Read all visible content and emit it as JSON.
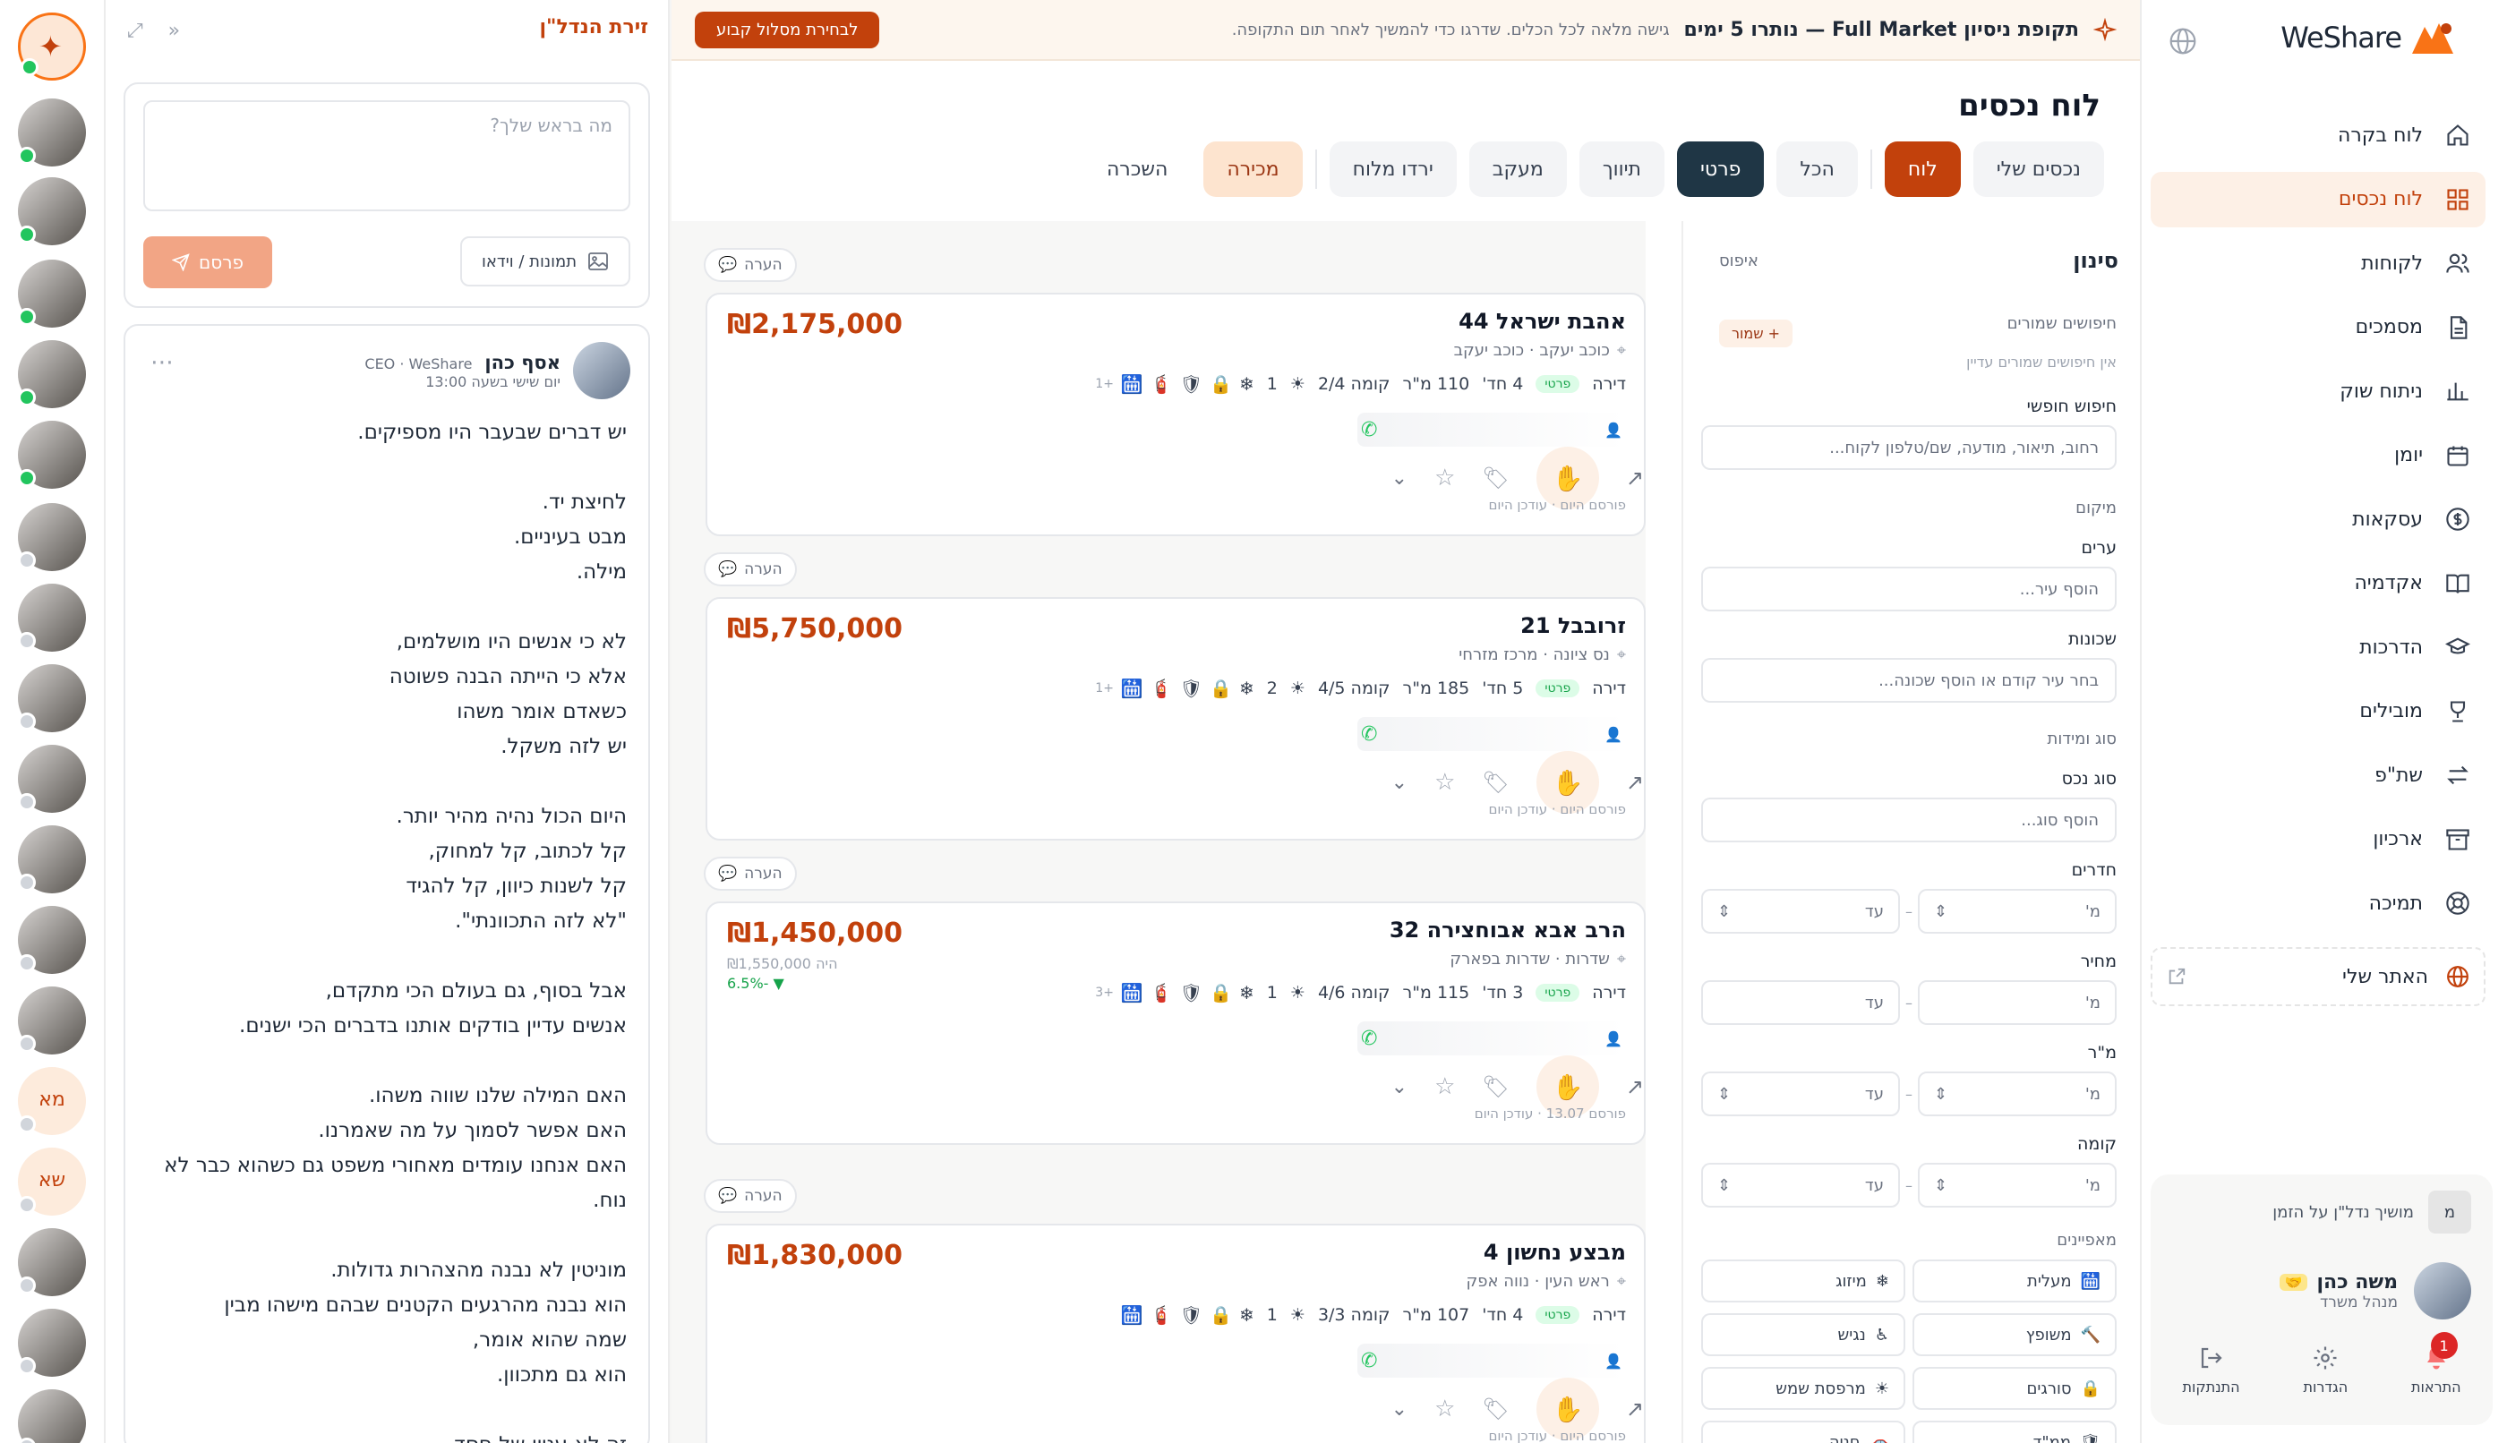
{
  "nav": {
    "logo": "WeShare",
    "items": [
      {
        "label": "לוח בקרה",
        "icon": "home-icon"
      },
      {
        "label": "לוח נכסים",
        "icon": "grid-icon",
        "active": true
      },
      {
        "label": "לקוחות",
        "icon": "users-icon"
      },
      {
        "label": "מסמכים",
        "icon": "document-icon"
      },
      {
        "label": "ניתוח שוק",
        "icon": "bar-chart-icon"
      },
      {
        "label": "יומן",
        "icon": "calendar-icon"
      },
      {
        "label": "עסקאות",
        "icon": "dollar-icon"
      },
      {
        "label": "אקדמיה",
        "icon": "book-icon"
      },
      {
        "label": "הדרכות",
        "icon": "graduation-cap-icon"
      },
      {
        "label": "מובילים",
        "icon": "trophy-icon"
      },
      {
        "label": "שת\"פ",
        "icon": "swap-icon"
      },
      {
        "label": "ארכיון",
        "icon": "archive-icon"
      },
      {
        "label": "תמיכה",
        "icon": "lifebuoy-icon"
      }
    ],
    "my_site": "האתר שלי",
    "sync": {
      "initial": "מ",
      "text": "מושיך נדל\"ן על הזמן"
    },
    "user": {
      "name": "משה כהן",
      "role": "מנהל משרד"
    },
    "actions": {
      "notifications": "התראות",
      "notifications_count": "1",
      "settings": "הגדרות",
      "logout": "התנתקות"
    }
  },
  "banner": {
    "title": "תקופת ניסיון Full Market — נותרו 5 ימים",
    "text": "גישה מלאה לכל הכלים. שדרגו כדי להמשיך לאחר תום התקופה.",
    "cta": "לבחירת מסלול קבוע"
  },
  "main": {
    "title": "לוח נכסים",
    "tabs_group1": [
      "נכסים שלי",
      "לוח"
    ],
    "tabs_group2": [
      "הכל",
      "פרטי",
      "תיווך",
      "מעקב",
      "ירדו מלוח"
    ],
    "tabs_group3": [
      "מכירה",
      "השכרה"
    ]
  },
  "filters": {
    "title": "סינון",
    "reset": "איפוס",
    "saved_label": "חיפושים שמורים",
    "save_btn": "+ שמור",
    "saved_empty": "אין חיפושים שמורים עדיין",
    "free_search_label": "חיפוש חופשי",
    "free_search_placeholder": "רחוב, תיאור, מודעה, שם/טלפון לקוח...",
    "location_label": "מיקום",
    "cities_label": "ערים",
    "cities_placeholder": "הוסף עיר...",
    "hoods_label": "שכונות",
    "hoods_placeholder": "בחר עיר קודם או הוסף שכונה...",
    "type_section": "סוג ומידות",
    "type_label": "סוג נכס",
    "type_placeholder": "הוסף סוג...",
    "rooms_label": "חדרים",
    "price_label": "מחיר",
    "sqm_label": "מ\"ר",
    "floor_label": "קומה",
    "from": "מ'",
    "to": "עד",
    "features_label": "מאפיינים",
    "features": [
      {
        "label": "מעלית",
        "icon": "elevator-icon"
      },
      {
        "label": "מיזוג",
        "icon": "snowflake-icon"
      },
      {
        "label": "משופץ",
        "icon": "hammer-icon"
      },
      {
        "label": "נגיש",
        "icon": "wheelchair-icon"
      },
      {
        "label": "סורגים",
        "icon": "lock-icon"
      },
      {
        "label": "מרפסת שמש",
        "icon": "sun-icon"
      },
      {
        "label": "ממ\"ד",
        "icon": "shield-icon"
      },
      {
        "label": "חניה",
        "icon": "car-icon"
      }
    ]
  },
  "note_label": "הערה",
  "listings": [
    {
      "address": "אהבת ישראל 44",
      "area": "כוכב יעקב · כוכב יעקב",
      "price": "₪2,175,000",
      "type": "דירה",
      "badge": "פרטי",
      "rooms": "4 חד'",
      "sqm": "110 מ\"ר",
      "floor": "קומה 2/4",
      "balconies": "1",
      "more": "+1",
      "posted": "פורסם היום · עודכן היום"
    },
    {
      "address": "זרובבל 21",
      "area": "נס ציונה · מרכז מזרחי",
      "price": "₪5,750,000",
      "type": "דירה",
      "badge": "פרטי",
      "rooms": "5 חד'",
      "sqm": "185 מ\"ר",
      "floor": "קומה 4/5",
      "balconies": "2",
      "more": "+1",
      "posted": "פורסם היום · עודכן היום"
    },
    {
      "address": "הרב אבא אבוחצירה 32",
      "area": "שדרות · שדרות בפארק",
      "price": "₪1,450,000",
      "old_price": "היה ₪1,550,000",
      "change": "▼ -6.5%",
      "type": "דירה",
      "badge": "פרטי",
      "rooms": "3 חד'",
      "sqm": "115 מ\"ר",
      "floor": "קומה 4/6",
      "balconies": "1",
      "more": "+3",
      "posted": "פורסם 13.07 · עודכן היום"
    },
    {
      "address": "מבצע נחשון 4",
      "area": "ראש העין · נווה אפק",
      "price": "₪1,830,000",
      "type": "דירה",
      "badge": "פרטי",
      "rooms": "4 חד'",
      "sqm": "107 מ\"ר",
      "floor": "קומה 3/3",
      "balconies": "1",
      "more": "",
      "posted": "פורסם היום · עודכן היום"
    }
  ],
  "feed": {
    "title": "זירת הנדל\"ן",
    "placeholder": "מה בראש שלך?",
    "media": "תמונות / וידאו",
    "publish": "פרסם",
    "post": {
      "author": "אסף כהן",
      "role": "CEO · WeShare",
      "time": "יום שישי בשעה 13:00",
      "paragraphs": [
        "יש דברים שבעבר היו מספיקים.",
        "לחיצת יד.\nמבט בעיניים.\nמילה.",
        "לא כי אנשים היו מושלמים,\nאלא כי הייתה הבנה פשוטה\nכשאדם אומר משהו\nיש לזה משקל.",
        "היום הכול נהיה מהיר יותר.\nקל לכתוב, קל למחוק,\nקל לשנות כיוון, קל להגיד\n\"לא לזה התכוונתי\".",
        "אבל בסוף, גם בעולם הכי מתקדם,\nאנשים עדיין בודקים אותנו בדברים הכי ישנים.",
        "האם המילה שלנו שווה משהו.\nהאם אפשר לסמוך על מה שאמרנו.\nהאם אנחנו עומדים מאחורי משפט גם כשהוא כבר לא נוח.",
        "מוניטין לא נבנה מהצהרות גדולות.\nהוא נבנה מהרגעים הקטנים שבהם מישהו מבין\nשמה שהוא אומר,\nהוא גם מתכוון.",
        "זה לא עניין של חסד"
      ]
    }
  },
  "rail": {
    "avatars": [
      {
        "initials": "מא",
        "status": "offline"
      },
      {
        "initials": "שא",
        "status": "offline"
      }
    ]
  },
  "colors": {
    "accent": "#c2410c",
    "dark_tab": "#1f3645",
    "online": "#22c55e"
  }
}
